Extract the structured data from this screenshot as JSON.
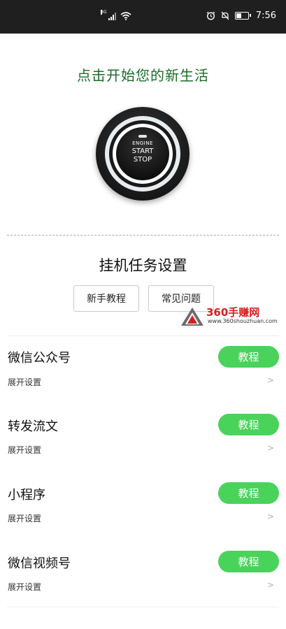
{
  "status_bar": {
    "network_type": "3G",
    "icons": [
      "signal-icon",
      "wifi-icon",
      "alarm-icon",
      "mute-icon",
      "battery-icon"
    ],
    "time": "7:56"
  },
  "hero": {
    "title": "点击开始您的新生活",
    "title_color": "#1b6b2a",
    "button": {
      "engine": "ENGINE",
      "start": "START",
      "stop": "STOP"
    }
  },
  "section": {
    "title": "挂机任务设置",
    "tutorial_label": "新手教程",
    "faq_label": "常见问题"
  },
  "watermark": {
    "brand": "360手赚网",
    "url": "www.360shouzhuan.com"
  },
  "tasks": [
    {
      "name": "微信公众号",
      "sub": "展开设置",
      "action": "教程"
    },
    {
      "name": "转发流文",
      "sub": "展开设置",
      "action": "教程"
    },
    {
      "name": "小程序",
      "sub": "展开设置",
      "action": "教程"
    },
    {
      "name": "微信视频号",
      "sub": "展开设置",
      "action": "教程"
    }
  ],
  "colors": {
    "accent_green": "#49d35a",
    "status_bar": "#1f1f1f"
  }
}
